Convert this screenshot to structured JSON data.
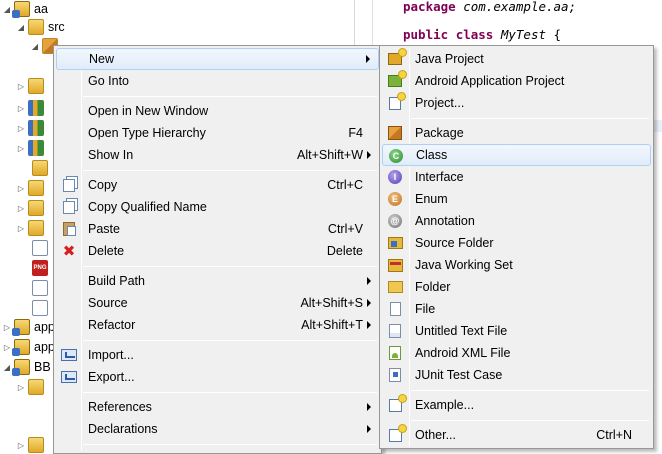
{
  "explorer": {
    "nodes": [
      {
        "label": "aa",
        "icon": "project-icon"
      },
      {
        "label": "src",
        "icon": "source-folder-icon"
      },
      {
        "label": "app",
        "icon": "project-icon"
      },
      {
        "label": "app",
        "icon": "project-icon"
      },
      {
        "label": "BB",
        "icon": "project-icon"
      }
    ]
  },
  "editor": {
    "line1_kw": "package",
    "line1_rest": "com.example.aa;",
    "line2_kw1": "public",
    "line2_kw2": "class",
    "line2_name": "MyTest",
    "line2_brace": "{"
  },
  "context_menu": {
    "items": [
      {
        "label": "New",
        "submenu": true,
        "highlighted": true
      },
      {
        "label": "Go Into"
      },
      {
        "label": "Open in New Window"
      },
      {
        "label": "Open Type Hierarchy",
        "accel": "F4"
      },
      {
        "label": "Show In",
        "accel": "Alt+Shift+W",
        "submenu": true
      },
      {
        "label": "Copy",
        "accel": "Ctrl+C",
        "icon": "copy-icon"
      },
      {
        "label": "Copy Qualified Name",
        "icon": "copy-qualified-name-icon"
      },
      {
        "label": "Paste",
        "accel": "Ctrl+V",
        "icon": "paste-icon"
      },
      {
        "label": "Delete",
        "accel": "Delete",
        "icon": "delete-icon"
      },
      {
        "label": "Build Path",
        "submenu": true
      },
      {
        "label": "Source",
        "accel": "Alt+Shift+S",
        "submenu": true
      },
      {
        "label": "Refactor",
        "accel": "Alt+Shift+T",
        "submenu": true
      },
      {
        "label": "Import...",
        "icon": "import-icon"
      },
      {
        "label": "Export...",
        "icon": "export-icon"
      },
      {
        "label": "References",
        "submenu": true
      },
      {
        "label": "Declarations",
        "submenu": true
      }
    ]
  },
  "new_submenu": {
    "items": [
      {
        "label": "Java Project",
        "icon": "java-project-icon"
      },
      {
        "label": "Android Application Project",
        "icon": "android-project-icon"
      },
      {
        "label": "Project...",
        "icon": "project-wizard-icon"
      },
      {
        "label": "Package",
        "icon": "package-icon"
      },
      {
        "label": "Class",
        "icon": "class-icon",
        "highlighted": true
      },
      {
        "label": "Interface",
        "icon": "interface-icon"
      },
      {
        "label": "Enum",
        "icon": "enum-icon"
      },
      {
        "label": "Annotation",
        "icon": "annotation-icon"
      },
      {
        "label": "Source Folder",
        "icon": "source-folder-icon"
      },
      {
        "label": "Java Working Set",
        "icon": "working-set-icon"
      },
      {
        "label": "Folder",
        "icon": "folder-icon"
      },
      {
        "label": "File",
        "icon": "file-icon"
      },
      {
        "label": "Untitled Text File",
        "icon": "text-file-icon"
      },
      {
        "label": "Android XML File",
        "icon": "android-xml-icon"
      },
      {
        "label": "JUnit Test Case",
        "icon": "junit-icon"
      },
      {
        "label": "Example...",
        "icon": "example-icon"
      },
      {
        "label": "Other...",
        "accel": "Ctrl+N",
        "icon": "other-wizard-icon"
      }
    ]
  },
  "colors": {
    "keyword": "#7f0055",
    "menu_bg": "#f0f0f0",
    "highlight_border": "#aecff7"
  }
}
